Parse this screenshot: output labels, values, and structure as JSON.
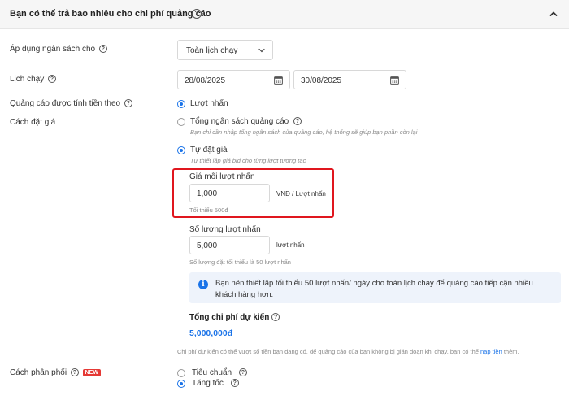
{
  "section": {
    "title": "Bạn có thể trả bao nhiêu cho chi phí quảng cáo"
  },
  "budget_scope": {
    "label": "Áp dụng ngân sách cho",
    "value": "Toàn lịch chạy"
  },
  "schedule": {
    "label": "Lịch chạy",
    "start_date": "28/08/2025",
    "end_date": "30/08/2025"
  },
  "charging": {
    "label": "Quảng cáo được tính tiền theo",
    "option": "Lượt nhấn"
  },
  "bidding": {
    "label": "Cách đặt giá",
    "total_budget": {
      "label": "Tổng ngân sách quảng cáo",
      "hint": "Bạn chỉ cần nhập tổng ngân sách của quảng cáo, hệ thống sẽ giúp bạn phần còn lại"
    },
    "manual": {
      "label": "Tự đặt giá",
      "hint": "Tự thiết lập giá bid cho từng lượt tương tác"
    },
    "price_per_click": {
      "label": "Giá mỗi lượt nhấn",
      "value": "1,000",
      "unit": "VNĐ / Lượt nhấn",
      "min_note": "Tối thiểu 500đ"
    },
    "click_count": {
      "label": "Số lượng lượt nhấn",
      "value": "5,000",
      "unit": "lượt nhấn",
      "min_note": "Số lượng đặt tối thiểu là 50 lượt nhấn"
    },
    "info": "Bạn nên thiết lập tối thiểu 50 lượt nhấn/ ngày cho toàn lịch chạy để quảng cáo tiếp cận nhiều khách hàng hơn.",
    "estimated_total_label": "Tổng chi phí dự kiến",
    "estimated_total_value": "5,000,000đ",
    "note_prefix": "Chi phí dự kiến có thể vượt số tiền bạn đang có, để quảng cáo của bạn không bị gián đoạn khi chạy, bạn có thể",
    "note_link": "nạp tiền",
    "note_suffix": "thêm."
  },
  "distribution": {
    "label": "Cách phân phối",
    "badge": "NEW",
    "options": [
      "Tiêu chuẩn",
      "Tăng tốc"
    ],
    "selected": "Tăng tốc"
  },
  "colors": {
    "accent": "#1a73e8",
    "highlight": "#e0161e",
    "badge": "#e53935",
    "info_bg": "#eef3fb"
  }
}
